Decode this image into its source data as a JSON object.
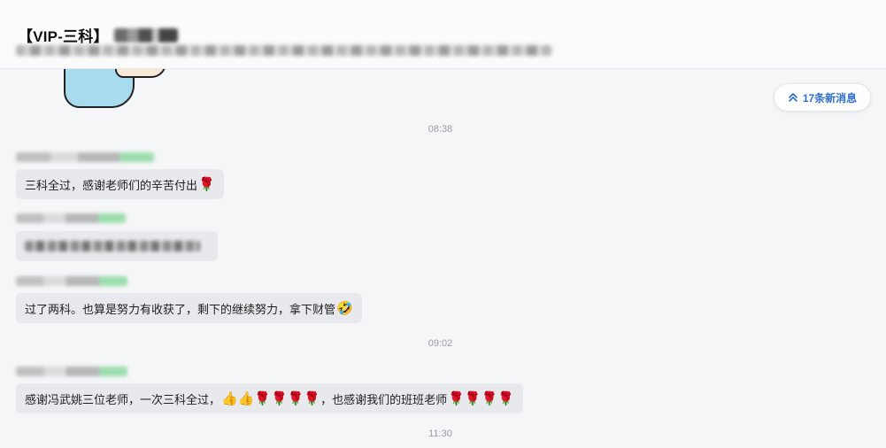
{
  "header": {
    "title": "【VIP-三科】"
  },
  "new_messages_pill": {
    "label": "17条新消息"
  },
  "timestamps": [
    "08:38",
    "09:02",
    "11:30"
  ],
  "messages": [
    {
      "text": "三科全过，感谢老师们的辛苦付出",
      "emoji": "🌹"
    },
    {
      "text": "过了两科。也算是努力有收获了，剩下的继续努力，拿下财管",
      "emoji": "🤣"
    },
    {
      "text": "感谢冯武姚三位老师，一次三科全过，",
      "emoji_a": "👍👍🌹🌹🌹🌹",
      "text_b": "，也感谢我们的班班老师",
      "emoji_b": "🌹🌹🌹🌹"
    }
  ],
  "icons": {
    "new_messages": "double-chevron-up-icon"
  },
  "colors": {
    "accent": "#2f6fcb",
    "bubble": "#e8e9ec",
    "background": "#f5f6f8"
  }
}
